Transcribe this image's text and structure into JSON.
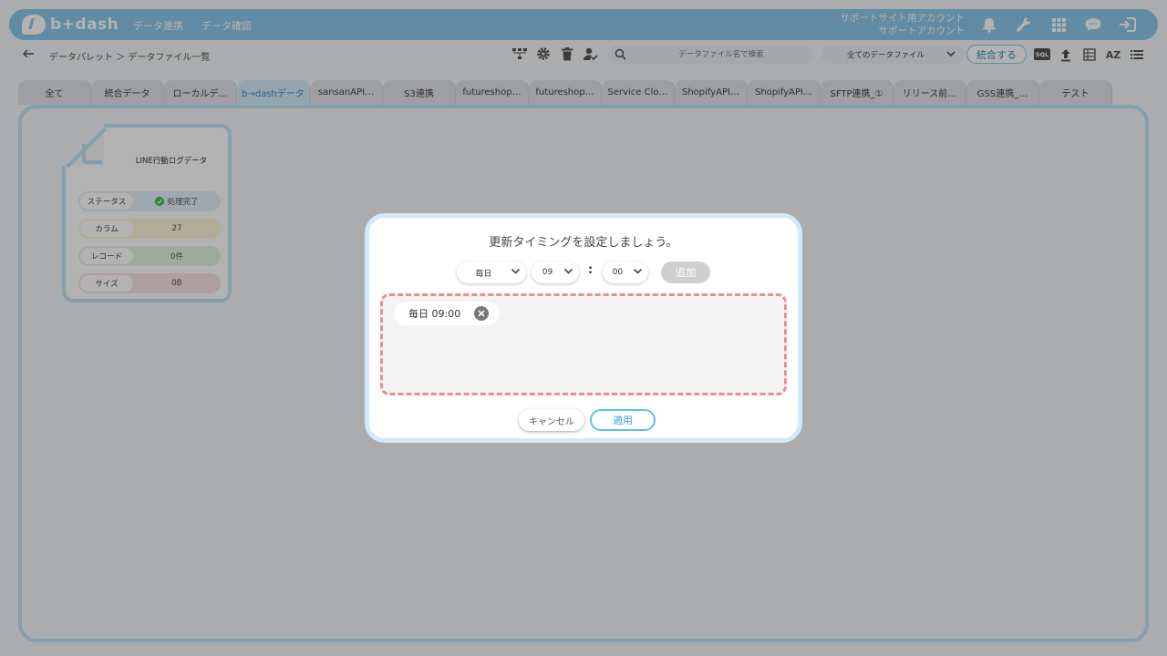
{
  "app": {
    "logo_text": "b+dash"
  },
  "header": {
    "nav": [
      "データ連携",
      "データ確認"
    ],
    "account_line1": "サポートサイト用アカウント",
    "account_line2": "サポートアカウント",
    "icons": [
      "bell-icon",
      "wrench-icon",
      "grid-icon",
      "chat-icon",
      "logout-icon"
    ]
  },
  "toolbar": {
    "breadcrumb": "データパレット ＞ データファイル一覧",
    "search_placeholder": "データファイル名で検索",
    "filter_value": "全てのデータファイル",
    "merge_label": "統合する",
    "sql_label": "SQL",
    "az_label": "AZ"
  },
  "tabs": [
    {
      "label": "全て",
      "active": false
    },
    {
      "label": "統合データ",
      "active": false
    },
    {
      "label": "ローカルデ…",
      "active": false
    },
    {
      "label": "b→dashデータ",
      "active": true
    },
    {
      "label": "sansanAPI…",
      "active": false
    },
    {
      "label": "S3連携",
      "active": false
    },
    {
      "label": "futureshop…",
      "active": false
    },
    {
      "label": "futureshop…",
      "active": false
    },
    {
      "label": "Service Clo…",
      "active": false
    },
    {
      "label": "ShopifyAPI…",
      "active": false
    },
    {
      "label": "ShopifyAPI…",
      "active": false
    },
    {
      "label": "SFTP連携_①",
      "active": false
    },
    {
      "label": "リリース前…",
      "active": false
    },
    {
      "label": "GSS連携_…",
      "active": false
    },
    {
      "label": "テスト",
      "active": false
    }
  ],
  "file_card": {
    "title": "LINE行動ログデータ",
    "rows": [
      {
        "label": "ステータス",
        "value": "処理完了"
      },
      {
        "label": "カラム",
        "value": "27"
      },
      {
        "label": "レコード",
        "value": "0件"
      },
      {
        "label": "サイズ",
        "value": "0B"
      }
    ]
  },
  "modal": {
    "title": "更新タイミングを設定しましょう。",
    "frequency": "毎日",
    "hour": "09",
    "colon": ":",
    "minute": "00",
    "add_label": "追加",
    "schedules": [
      "毎日 09:00"
    ],
    "cancel_label": "キャンセル",
    "apply_label": "適用"
  },
  "colors": {
    "brand": "#8cc9ea",
    "accent": "#3aa3d6",
    "dashed_border": "#f08a95",
    "status_ok": "#3fb950"
  }
}
